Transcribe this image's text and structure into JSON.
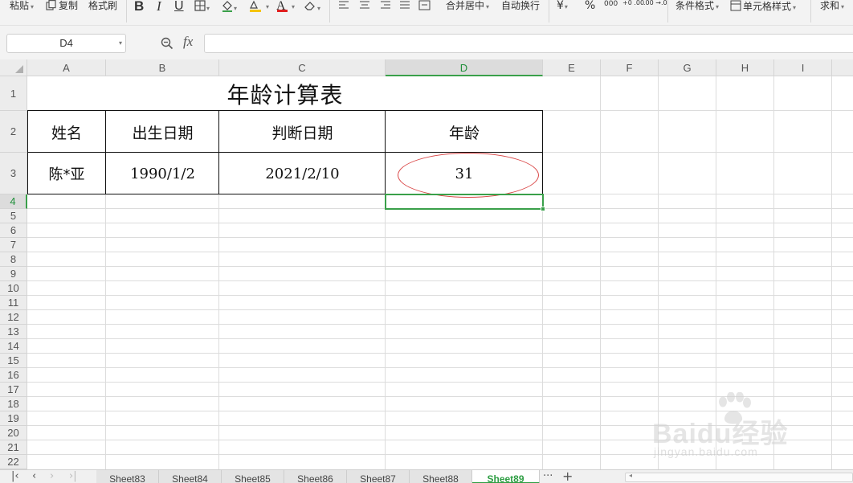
{
  "ribbon": {
    "paste": "粘贴",
    "copy": "复制",
    "format_painter": "格式刷",
    "merge_center": "合并居中",
    "wrap_text": "自动换行",
    "currency_symbol": "¥",
    "percent_symbol": "%",
    "thousands_symbol": "000",
    "inc_decimal_symbol": "+0 .00",
    "dec_decimal_symbol": ".00 →.0",
    "conditional_format": "条件格式",
    "cell_style": "单元格样式",
    "sum": "求和",
    "fill_color": "#f5c400",
    "font_color": "#e02020"
  },
  "formula_bar": {
    "name_box": "D4",
    "fx_label": "fx",
    "formula": ""
  },
  "columns": [
    "A",
    "B",
    "C",
    "D",
    "E",
    "F",
    "G",
    "H",
    "I"
  ],
  "active_column": "D",
  "rows": [
    "1",
    "2",
    "3",
    "4",
    "5",
    "6",
    "7",
    "8",
    "9",
    "10",
    "11",
    "12",
    "13",
    "14",
    "15",
    "16",
    "17",
    "18",
    "19",
    "20",
    "21",
    "22"
  ],
  "active_row": "4",
  "table": {
    "title": "年龄计算表",
    "headers": [
      "姓名",
      "出生日期",
      "判断日期",
      "年龄"
    ],
    "row": [
      "陈*亚",
      "1990/1/2",
      "2021/2/10",
      "31"
    ]
  },
  "annotation": {
    "ellipse_color": "#d94545",
    "selection_color": "#3aa04a"
  },
  "sheet_tabs": {
    "items": [
      "Sheet83",
      "Sheet84",
      "Sheet85",
      "Sheet86",
      "Sheet87",
      "Sheet88",
      "Sheet89"
    ],
    "active": "Sheet89",
    "more": "···",
    "add": "+"
  },
  "watermark": {
    "brand": "Baidu经验",
    "url": "jingyan.baidu.com"
  }
}
